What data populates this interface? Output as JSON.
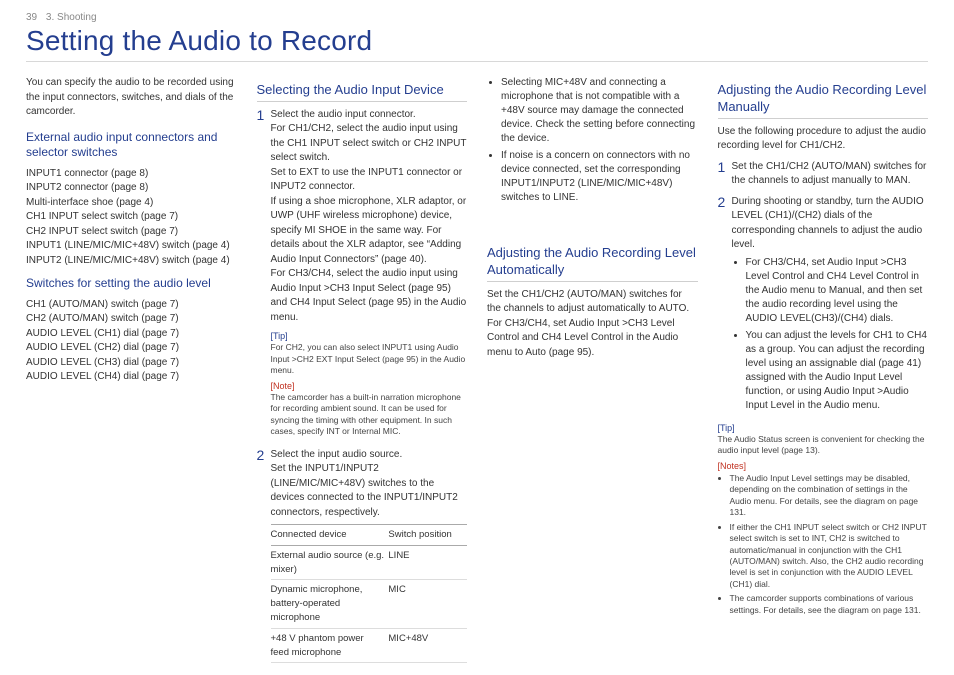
{
  "header": {
    "pageNumber": "39",
    "section": "3. Shooting"
  },
  "title": "Setting the Audio to Record",
  "col1": {
    "intro": "You can specify the audio to be recorded using the input connectors, switches, and dials of the camcorder.",
    "h_ext": "External audio input connectors and selector switches",
    "ext_list": "INPUT1 connector (page 8)\nINPUT2 connector (page 8)\nMulti-interface shoe (page 4)\nCH1 INPUT select switch (page 7)\nCH2 INPUT select switch (page 7)\nINPUT1 (LINE/MIC/MIC+48V) switch (page 4)\nINPUT2 (LINE/MIC/MIC+48V) switch (page 4)",
    "h_sw": "Switches for setting the audio level",
    "sw_list": "CH1 (AUTO/MAN) switch (page 7)\nCH2 (AUTO/MAN) switch (page 7)\nAUDIO LEVEL (CH1) dial (page 7)\nAUDIO LEVEL (CH2) dial (page 7)\nAUDIO LEVEL (CH3) dial (page 7)\nAUDIO LEVEL (CH4) dial (page 7)"
  },
  "col2": {
    "h_sel": "Selecting the Audio Input Device",
    "s1n": "1",
    "s1": "Select the audio input connector.\nFor CH1/CH2, select the audio input using the CH1 INPUT select switch or CH2 INPUT select switch.\nSet to EXT to use the INPUT1 connector or INPUT2 connector.\nIf using a shoe microphone, XLR adaptor, or UWP (UHF wireless microphone) device, specify MI SHOE in the same way. For details about the XLR adaptor, see “Adding Audio Input Connectors” (page 40).\nFor CH3/CH4, select the audio input using Audio Input >CH3 Input Select (page 95) and CH4 Input Select (page 95) in the Audio menu.",
    "tipL": "[Tip]",
    "tip": "For CH2, you can also select INPUT1 using Audio Input >CH2 EXT Input Select (page 95) in the Audio menu.",
    "noteL": "[Note]",
    "note": "The camcorder has a built-in narration microphone for recording ambient sound. It can be used for syncing the timing with other equipment. In such cases, specify INT or Internal MIC.",
    "s2n": "2",
    "s2": "Select the input audio source.\nSet the INPUT1/INPUT2 (LINE/MIC/MIC+48V) switches to the devices connected to the INPUT1/INPUT2 connectors, respectively.",
    "th1": "Connected device",
    "th2": "Switch position",
    "r1a": "External audio source (e.g. mixer)",
    "r1b": "LINE",
    "r2a": "Dynamic microphone, battery-operated microphone",
    "r2b": "MIC",
    "r3a": "+48 V phantom power feed microphone",
    "r3b": "MIC+48V"
  },
  "col3": {
    "b1": "Selecting MIC+48V and connecting a microphone that is not compatible with a +48V source may damage the connected device. Check the setting before connecting the device.",
    "b2": "If noise is a concern on connectors with no device connected, set the corresponding INPUT1/INPUT2 (LINE/MIC/MIC+48V) switches to LINE.",
    "h_auto": "Adjusting the Audio Recording Level Automatically",
    "auto": "Set the CH1/CH2 (AUTO/MAN) switches for the channels to adjust automatically to AUTO.\nFor CH3/CH4, set Audio Input >CH3 Level Control and CH4 Level Control in the Audio menu to Auto (page 95)."
  },
  "col4": {
    "h_man": "Adjusting the Audio Recording Level Manually",
    "intro": "Use the following procedure to adjust the audio recording level for CH1/CH2.",
    "s1n": "1",
    "s1": "Set the CH1/CH2 (AUTO/MAN) switches for the channels to adjust manually to MAN.",
    "s2n": "2",
    "s2": "During shooting or standby, turn the AUDIO LEVEL (CH1)/(CH2) dials of the corresponding channels to adjust the audio level.",
    "s2b1": "For CH3/CH4, set Audio Input >CH3 Level Control and CH4 Level Control in the Audio menu to Manual, and then set the audio recording level using the AUDIO LEVEL(CH3)/(CH4) dials.",
    "s2b2": "You can adjust the levels for CH1 to CH4 as a group. You can adjust the recording level using an assignable dial (page 41) assigned with the Audio Input Level function, or using Audio Input >Audio Input Level in the Audio menu.",
    "tipL": "[Tip]",
    "tip": "The Audio Status screen is convenient for checking the audio input level (page 13).",
    "notesL": "[Notes]",
    "n1": "The Audio Input Level settings may be disabled, depending on the combination of settings in the Audio menu. For details, see the diagram on page 131.",
    "n2": "If either the CH1 INPUT select switch or CH2 INPUT select switch is set to INT, CH2 is switched to automatic/manual in conjunction with the CH1 (AUTO/MAN) switch. Also, the CH2 audio recording level is set in conjunction with the AUDIO LEVEL (CH1) dial.",
    "n3": "The camcorder supports combinations of various settings. For details, see the diagram on page 131."
  }
}
